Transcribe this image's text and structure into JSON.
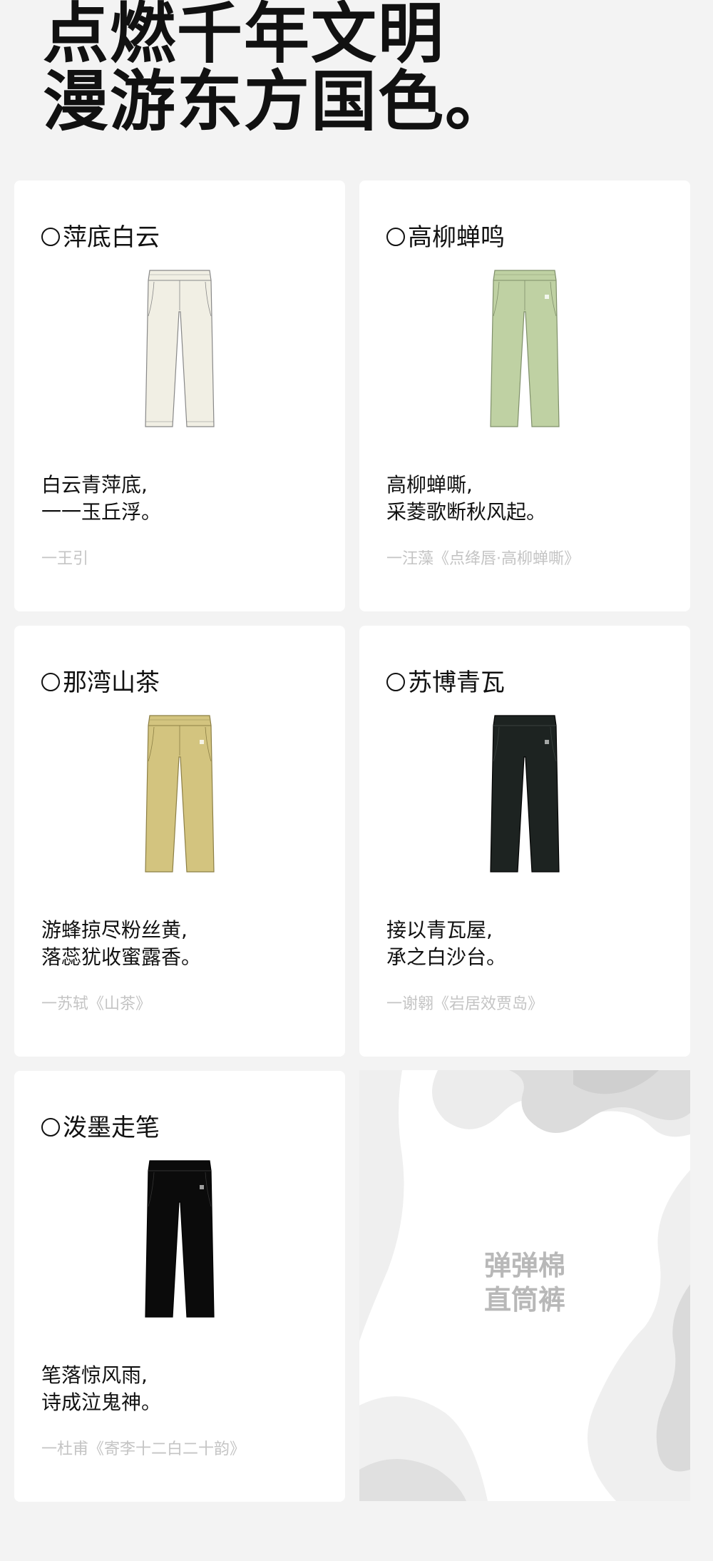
{
  "headline": {
    "line1": "点燃千年文明",
    "line2": "漫游东方国色。"
  },
  "cards": [
    {
      "title": "萍底白云",
      "poem_line1": "白云青萍底,",
      "poem_line2": "一一玉丘浮。",
      "source": "一王引",
      "color": "#f1efe4",
      "icon": "pants-icon"
    },
    {
      "title": "高柳蝉鸣",
      "poem_line1": "高柳蝉嘶,",
      "poem_line2": "采菱歌断秋风起。",
      "source": "一汪藻《点绛唇·高柳蝉嘶》",
      "color": "#bfd1a3",
      "icon": "pants-icon"
    },
    {
      "title": "那湾山茶",
      "poem_line1": "游蜂掠尽粉丝黄,",
      "poem_line2": "落蕊犹收蜜露香。",
      "source": "一苏轼《山茶》",
      "color": "#d3c47f",
      "icon": "pants-icon"
    },
    {
      "title": "苏博青瓦",
      "poem_line1": "接以青瓦屋,",
      "poem_line2": "承之白沙台。",
      "source": "一谢翱《岩居效贾岛》",
      "color": "#1d2321",
      "icon": "pants-icon"
    },
    {
      "title": "泼墨走笔",
      "poem_line1": "笔落惊风雨,",
      "poem_line2": "诗成泣鬼神。",
      "source": "一杜甫《寄李十二白二十韵》",
      "color": "#0b0b0b",
      "icon": "pants-icon"
    }
  ],
  "promo": {
    "line1": "弹弹棉",
    "line2": "直筒裤"
  }
}
